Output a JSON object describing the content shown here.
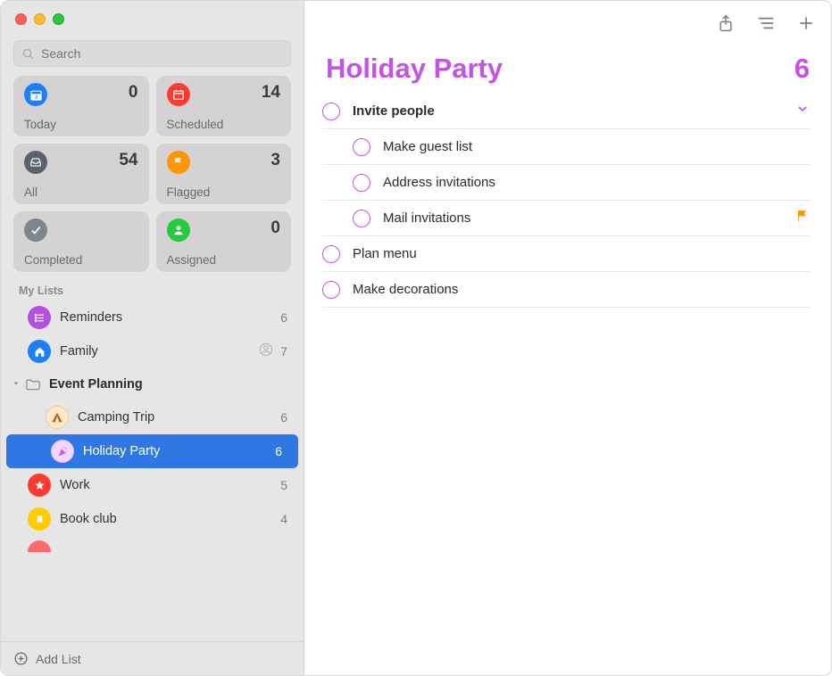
{
  "search": {
    "placeholder": "Search"
  },
  "smart_cards": [
    {
      "key": "today",
      "label": "Today",
      "count": 0,
      "bg": "#1b81f7"
    },
    {
      "key": "scheduled",
      "label": "Scheduled",
      "count": 14,
      "bg": "#fe3b30"
    },
    {
      "key": "all",
      "label": "All",
      "count": 54,
      "bg": "#5a626a"
    },
    {
      "key": "flagged",
      "label": "Flagged",
      "count": 3,
      "bg": "#ff9500"
    },
    {
      "key": "completed",
      "label": "Completed",
      "count": "",
      "bg": "#7d858d"
    },
    {
      "key": "assigned",
      "label": "Assigned",
      "count": 0,
      "bg": "#28c840"
    }
  ],
  "sections": {
    "my_lists": "My Lists"
  },
  "lists": {
    "reminders": {
      "name": "Reminders",
      "count": 6
    },
    "family": {
      "name": "Family",
      "count": 7
    },
    "group": {
      "name": "Event Planning"
    },
    "camping": {
      "name": "Camping Trip",
      "count": 6
    },
    "holiday": {
      "name": "Holiday Party",
      "count": 6
    },
    "work": {
      "name": "Work",
      "count": 5
    },
    "bookclub": {
      "name": "Book club",
      "count": 4
    }
  },
  "add_list_label": "Add List",
  "main": {
    "title": "Holiday Party",
    "count": 6,
    "reminders": [
      {
        "title": "Invite people",
        "bold": true,
        "parent": true
      },
      {
        "title": "Make guest list",
        "sub": true
      },
      {
        "title": "Address invitations",
        "sub": true
      },
      {
        "title": "Mail invitations",
        "sub": true,
        "flagged": true
      },
      {
        "title": "Plan menu"
      },
      {
        "title": "Make decorations"
      }
    ]
  }
}
